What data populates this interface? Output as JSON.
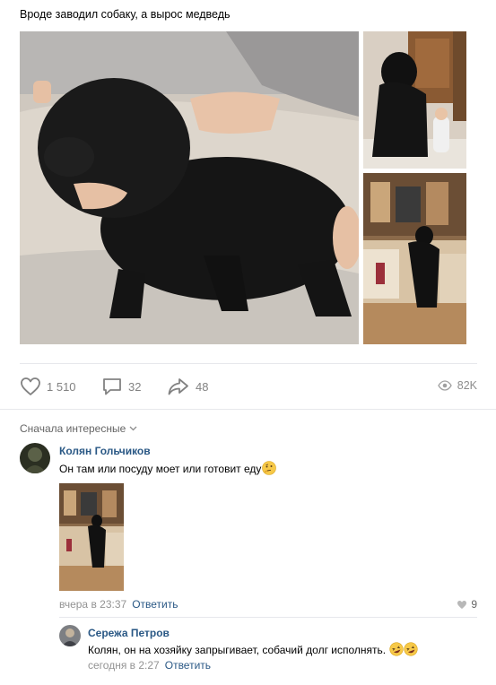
{
  "post": {
    "text": "Вроде заводил собаку, а вырос медведь"
  },
  "actions": {
    "likes": "1 510",
    "comments": "32",
    "shares": "48",
    "views": "82K"
  },
  "comments_section": {
    "sort_label": "Сначала интересные",
    "comment1": {
      "author": "Колян Гольчиков",
      "text": "Он там или посуду моет или готовит еду",
      "emoji": "thinking-face",
      "time": "вчера в 23:37",
      "reply_label": "Ответить",
      "likes": "9"
    },
    "comment2": {
      "author": "Сережа Петров",
      "text": "Колян, он на хозяйку запрыгивает, собачий долг исполнять.",
      "emoji": "rolling-laughing-face",
      "time": "сегодня в 2:27",
      "reply_label": "Ответить"
    }
  },
  "colors": {
    "link": "#2a5885",
    "muted": "#828282",
    "divider": "#e7e8ec"
  }
}
